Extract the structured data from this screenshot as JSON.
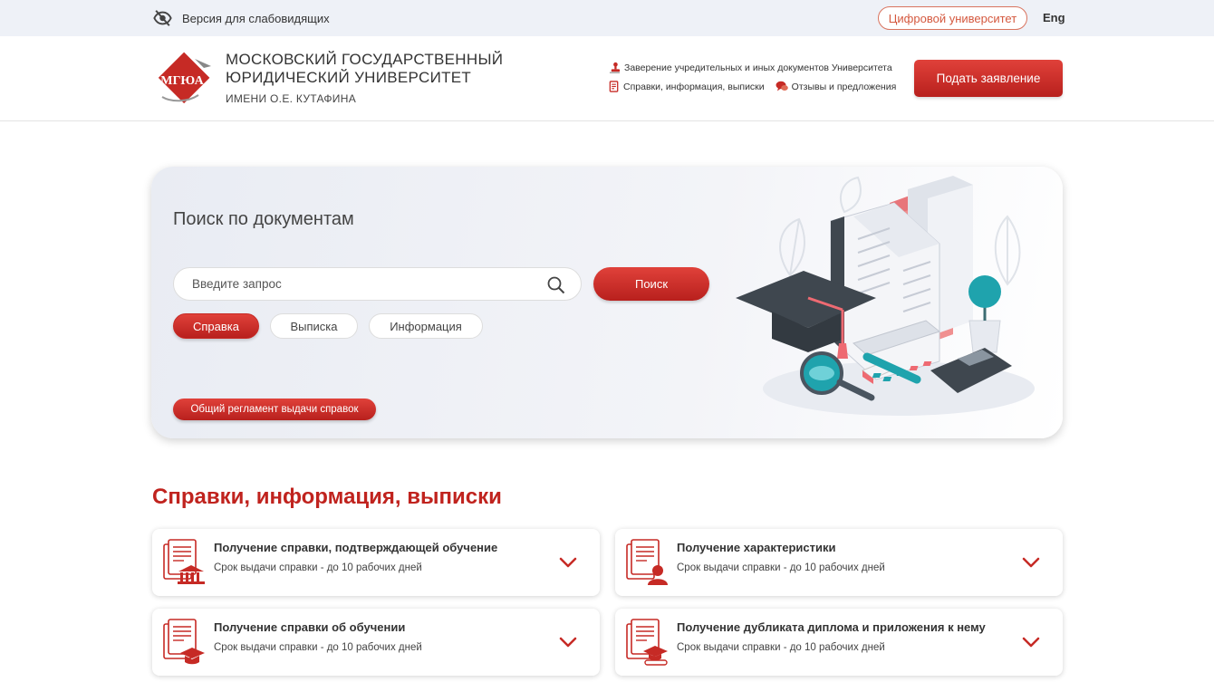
{
  "topbar": {
    "vision_label": "Версия для слабовидящих",
    "digital_label": "Цифровой университет",
    "lang_label": "Eng"
  },
  "header": {
    "logo_text": "МГЮА",
    "name_line1": "МОСКОВСКИЙ ГОСУДАРСТВЕННЫЙ",
    "name_line2": "ЮРИДИЧЕСКИЙ УНИВЕРСИТЕТ",
    "name_line3": "ИМЕНИ О.Е. КУТАФИНА",
    "links": {
      "certification": "Заверение учредительных и иных документов Университета",
      "certificates": "Справки, информация, выписки",
      "feedback": "Отзывы и предложения"
    },
    "apply_label": "Подать заявление"
  },
  "search": {
    "title": "Поиск по документам",
    "placeholder": "Введите запрос",
    "button_label": "Поиск",
    "chips": [
      "Справка",
      "Выписка",
      "Информация"
    ],
    "active_chip": "Справка",
    "reglament_label": "Общий регламент выдачи справок"
  },
  "section": {
    "title": "Справки, информация, выписки",
    "cards": [
      {
        "title": "Получение справки, подтверждающей обучение",
        "subtitle": "Срок выдачи справки - до 10 рабочих дней",
        "icon": "document-university-icon"
      },
      {
        "title": "Получение характеристики",
        "subtitle": "Срок выдачи справки - до 10 рабочих дней",
        "icon": "document-person-icon"
      },
      {
        "title": "Получение справки об обучении",
        "subtitle": "Срок выдачи справки - до 10 рабочих дней",
        "icon": "document-graduation-cap-icon"
      },
      {
        "title": "Получение дубликата диплома и приложения к нему",
        "subtitle": "Срок выдачи справки - до 10 рабочих дней",
        "icon": "document-diploma-icon"
      }
    ]
  },
  "colors": {
    "brand_red": "#c0231e",
    "accent_orange": "#d4583e",
    "topbar_bg": "#eef1f7"
  }
}
